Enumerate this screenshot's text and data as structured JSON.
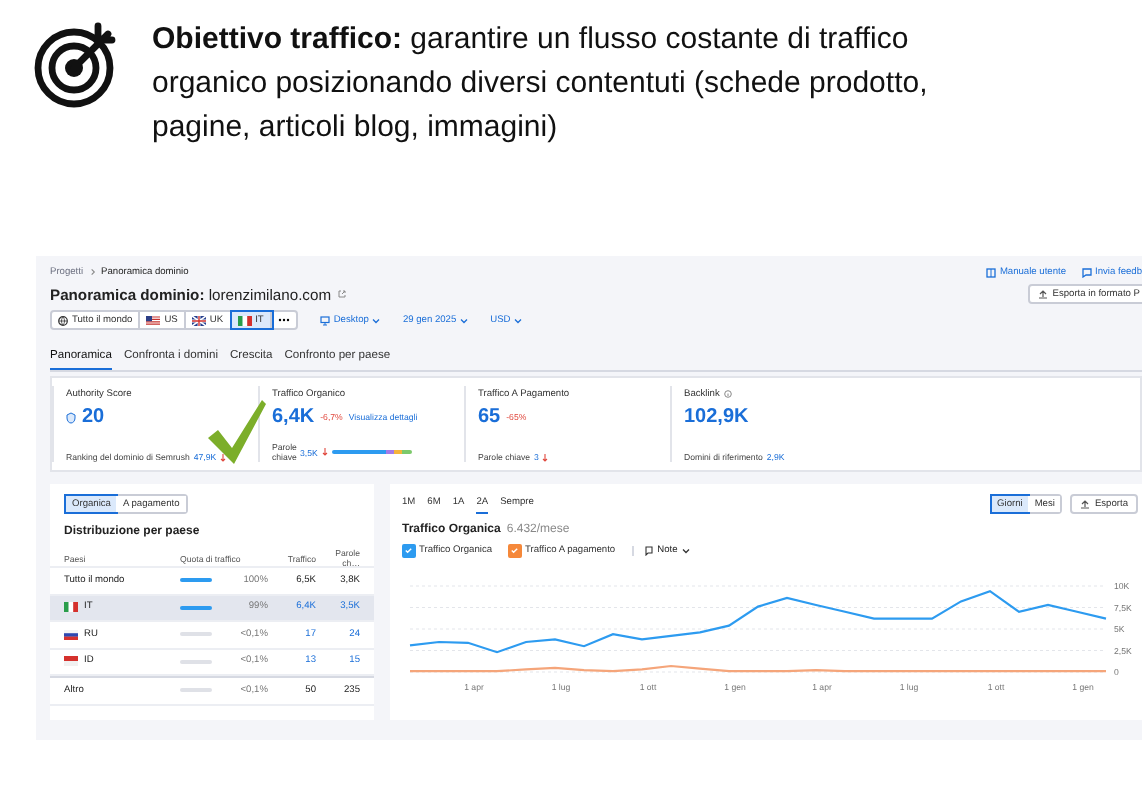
{
  "heading": "**Obiettivo traffico:** garantire un flusso costante di traffico organico posizionando diversi contentuti (schede prodotto, pagine, articoli blog, immagini)",
  "app": {
    "breadcrumb": [
      "Progetti",
      "Panoramica dominio"
    ],
    "header_links": [
      "Manuale utente",
      "Invia feedb"
    ],
    "title": {
      "label": "Panoramica dominio:",
      "domain": "lorenzimilano.com"
    },
    "export_button": "Esporta in formato P",
    "regions": [
      {
        "label": "Tutto il mondo",
        "kind": "globe",
        "selected": false
      },
      {
        "label": "US",
        "kind": "us",
        "selected": false
      },
      {
        "label": "UK",
        "kind": "uk",
        "selected": false
      },
      {
        "label": "IT",
        "kind": "it",
        "selected": true
      }
    ],
    "filters": [
      {
        "label": "Desktop",
        "kind": "device"
      },
      {
        "label": "29 gen 2025",
        "kind": "plain"
      },
      {
        "label": "USD",
        "kind": "plain"
      }
    ],
    "tabs": [
      {
        "label": "Panoramica",
        "selected": true
      },
      {
        "label": "Confronta i domini",
        "selected": false
      },
      {
        "label": "Crescita",
        "selected": false
      },
      {
        "label": "Confronto per paese",
        "selected": false
      }
    ],
    "metrics": [
      {
        "kind": "score",
        "title": "Authority Score",
        "value": "20",
        "footer_label": "Ranking del dominio di Semrush",
        "footer_value": "47,9K"
      },
      {
        "kind": "traffic",
        "title": "Traffico Organico",
        "value": "6,4K",
        "change": "-6,7%",
        "link": "Visualizza dettagli",
        "footer_label": "Parole chiave",
        "footer_value": "3,5K"
      },
      {
        "kind": "paid",
        "title": "Traffico A Pagamento",
        "value": "65",
        "change": "-65%",
        "footer_label": "Parole chiave",
        "footer_value": "3"
      },
      {
        "kind": "backlink",
        "title": "Backlink",
        "value": "102,9K",
        "footer_label": "Domini di riferimento",
        "footer_value": "2,9K"
      }
    ],
    "country_panel": {
      "toggle": [
        {
          "label": "Organica",
          "selected": true
        },
        {
          "label": "A pagamento",
          "selected": false
        }
      ],
      "title": "Distribuzione per paese",
      "columns": [
        "Paesi",
        "Quota di traffico",
        "Traffico",
        "Parole ch…"
      ],
      "rows": [
        {
          "kind": "total",
          "country": "Tutto il mondo",
          "level": 1.0,
          "share": "100%",
          "traffic": "6,5K",
          "keywords": "3,8K",
          "selected": false
        },
        {
          "kind": "it",
          "country": "IT",
          "level": 0.99,
          "share": "99%",
          "traffic": "6,4K",
          "keywords": "3,5K",
          "selected": true
        },
        {
          "kind": "ru",
          "country": "RU",
          "level": 0.001,
          "share": "<0,1%",
          "traffic": "17",
          "keywords": "24",
          "selected": false
        },
        {
          "kind": "id",
          "country": "ID",
          "level": 0.001,
          "share": "<0,1%",
          "traffic": "13",
          "keywords": "15",
          "selected": false
        },
        {
          "kind": "other",
          "country": "Altro",
          "level": 0.001,
          "share": "<0,1%",
          "traffic": "50",
          "keywords": "235",
          "selected": false
        }
      ]
    },
    "chart_panel": {
      "ranges": [
        {
          "label": "1M",
          "selected": false
        },
        {
          "label": "6M",
          "selected": false
        },
        {
          "label": "1A",
          "selected": false
        },
        {
          "label": "2A",
          "selected": true
        },
        {
          "label": "Sempre",
          "selected": false
        }
      ],
      "granularity": [
        {
          "label": "Giorni",
          "selected": true
        },
        {
          "label": "Mesi",
          "selected": false
        }
      ],
      "export": "Esporta",
      "title": "Traffico Organica",
      "subtitle": "6.432/mese",
      "legend": [
        {
          "checked": true,
          "color": "#2d9bf0"
        },
        {
          "checked": true,
          "color": "#f5883a"
        }
      ],
      "notes": "Note",
      "chart_data": {
        "type": "line",
        "categories": [
          null,
          null,
          "1 apr",
          null,
          null,
          "1 lug",
          null,
          null,
          "1 ott",
          null,
          null,
          "1 gen",
          null,
          null,
          "1 apr",
          null,
          null,
          "1 lug",
          null,
          null,
          "1 ott",
          null,
          null,
          "1 gen",
          null
        ],
        "series": [
          {
            "name": "Traffico Organica",
            "color": "#2d9bf0",
            "values": [
              3100,
              3500,
              3400,
              2300,
              3500,
              3800,
              3000,
              4400,
              3800,
              4200,
              4600,
              5400,
              7600,
              8600,
              7800,
              7000,
              6200,
              6200,
              6200,
              8200,
              9400,
              7000,
              7800,
              7000,
              6200
            ]
          },
          {
            "name": "Traffico A pagamento",
            "color": "#f5a57a",
            "values": [
              100,
              100,
              100,
              100,
              300,
              500,
              200,
              100,
              300,
              700,
              400,
              100,
              100,
              100,
              200,
              100,
              100,
              100,
              100,
              100,
              100,
              100,
              100,
              100,
              100
            ]
          }
        ],
        "ylim": [
          0,
          10000
        ],
        "grid": true,
        "yticks": [
          {
            "value": 0,
            "label": "0"
          },
          {
            "value": 2500,
            "label": "2,5K"
          },
          {
            "value": 5000,
            "label": "5K"
          },
          {
            "value": 7500,
            "label": "7,5K"
          },
          {
            "value": 10000,
            "label": "10K"
          }
        ]
      }
    }
  }
}
